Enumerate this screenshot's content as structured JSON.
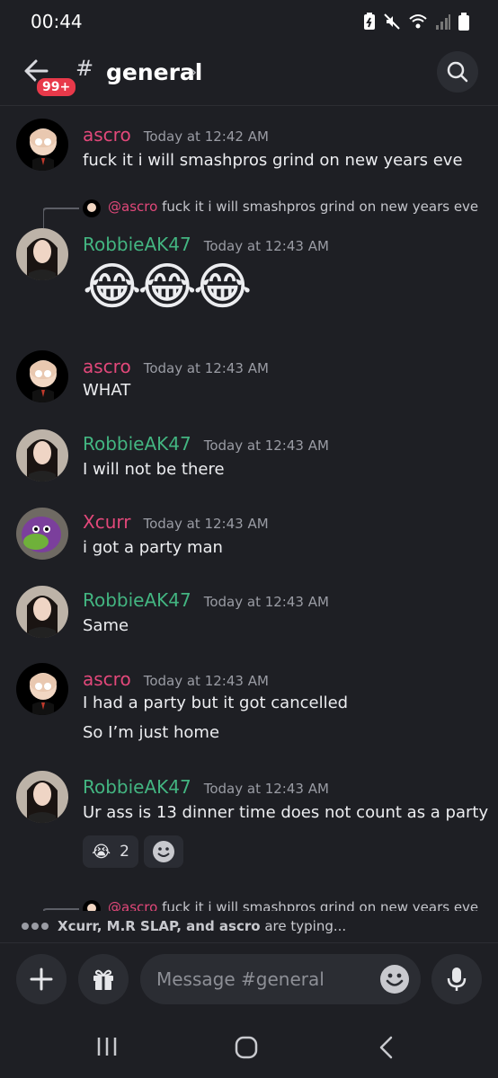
{
  "status_bar": {
    "time": "00:44"
  },
  "header": {
    "unread_badge": "99+",
    "channel_name": "general"
  },
  "messages": [
    {
      "author": "ascro",
      "timestamp": "Today at 12:42 AM",
      "lines": [
        "fuck it i will smashpros grind on new years eve"
      ]
    },
    {
      "reply_to": {
        "mention": "@ascro",
        "text": "fuck it i will smashpros grind on new years eve"
      },
      "author": "RobbieAK47",
      "timestamp": "Today at 12:43 AM",
      "lines": [
        "😂😂😂"
      ]
    },
    {
      "author": "ascro",
      "timestamp": "Today at 12:43 AM",
      "lines": [
        "WHAT"
      ]
    },
    {
      "author": "RobbieAK47",
      "timestamp": "Today at 12:43 AM",
      "lines": [
        "I will not be there"
      ]
    },
    {
      "author": "Xcurr",
      "timestamp": "Today at 12:43 AM",
      "lines": [
        "i got a party man"
      ]
    },
    {
      "author": "RobbieAK47",
      "timestamp": "Today at 12:43 AM",
      "lines": [
        "Same"
      ]
    },
    {
      "author": "ascro",
      "timestamp": "Today at 12:43 AM",
      "lines": [
        "I had a party but it got cancelled",
        "So I’m just home"
      ]
    },
    {
      "author": "RobbieAK47",
      "timestamp": "Today at 12:43 AM",
      "lines": [
        "Ur ass is 13 dinner time does not count as a party"
      ],
      "reactions": [
        {
          "emoji": "😭",
          "count": "2"
        }
      ]
    },
    {
      "reply_to": {
        "mention": "@ascro",
        "text": "fuck it i will smashpros grind on new years eve"
      }
    }
  ],
  "typing": {
    "users": "Xcurr, M.R SLAP, and ascro",
    "suffix": " are typing..."
  },
  "composer": {
    "placeholder": "Message #general"
  },
  "colors": {
    "ascro": "#e2487a",
    "robbie": "#43b581",
    "xcurr": "#e2487a",
    "background": "#1e1f24"
  }
}
